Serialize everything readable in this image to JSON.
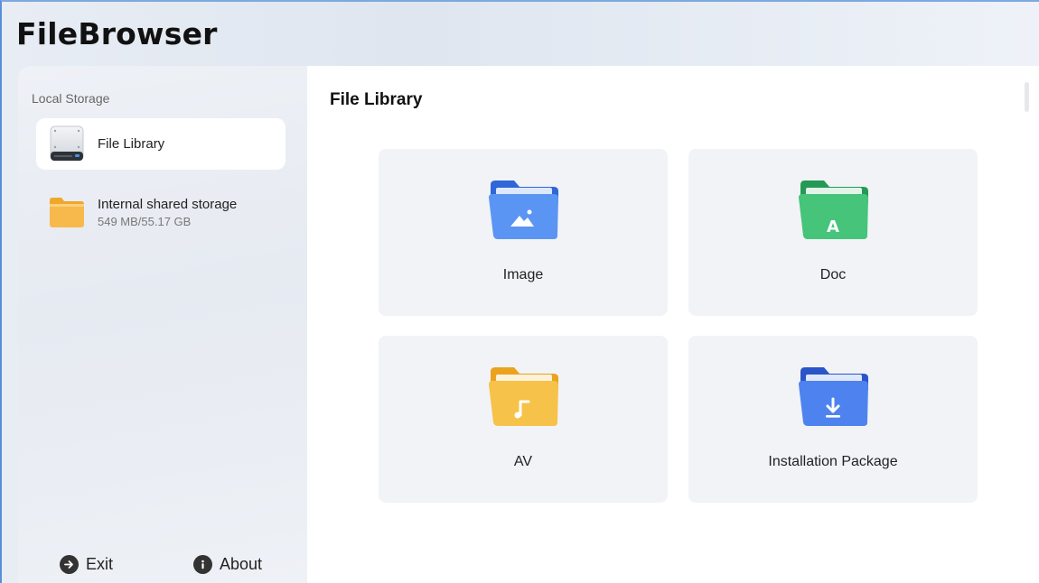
{
  "app": {
    "title": "FileBrowser"
  },
  "sidebar": {
    "section_label": "Local Storage",
    "items": [
      {
        "label": "File Library",
        "icon": "hard-drive-icon",
        "active": true
      },
      {
        "label": "Internal shared storage",
        "sub": "549 MB/55.17 GB",
        "icon": "orange-folder-icon",
        "active": false
      }
    ],
    "footer": {
      "exit_label": "Exit",
      "about_label": "About"
    }
  },
  "main": {
    "title": "File Library",
    "cards": [
      {
        "label": "Image",
        "icon": "image-folder-icon",
        "color": "#3f7ef2"
      },
      {
        "label": "Doc",
        "icon": "doc-folder-icon",
        "color": "#35b36a"
      },
      {
        "label": "AV",
        "icon": "audio-folder-icon",
        "color": "#f4b42c"
      },
      {
        "label": "Installation Package",
        "icon": "package-folder-icon",
        "color": "#3f6fe6"
      }
    ]
  },
  "colors": {
    "window_border": "#5a8fd8",
    "sidebar_bg": "#eef1f6",
    "card_bg": "#f1f3f7"
  }
}
